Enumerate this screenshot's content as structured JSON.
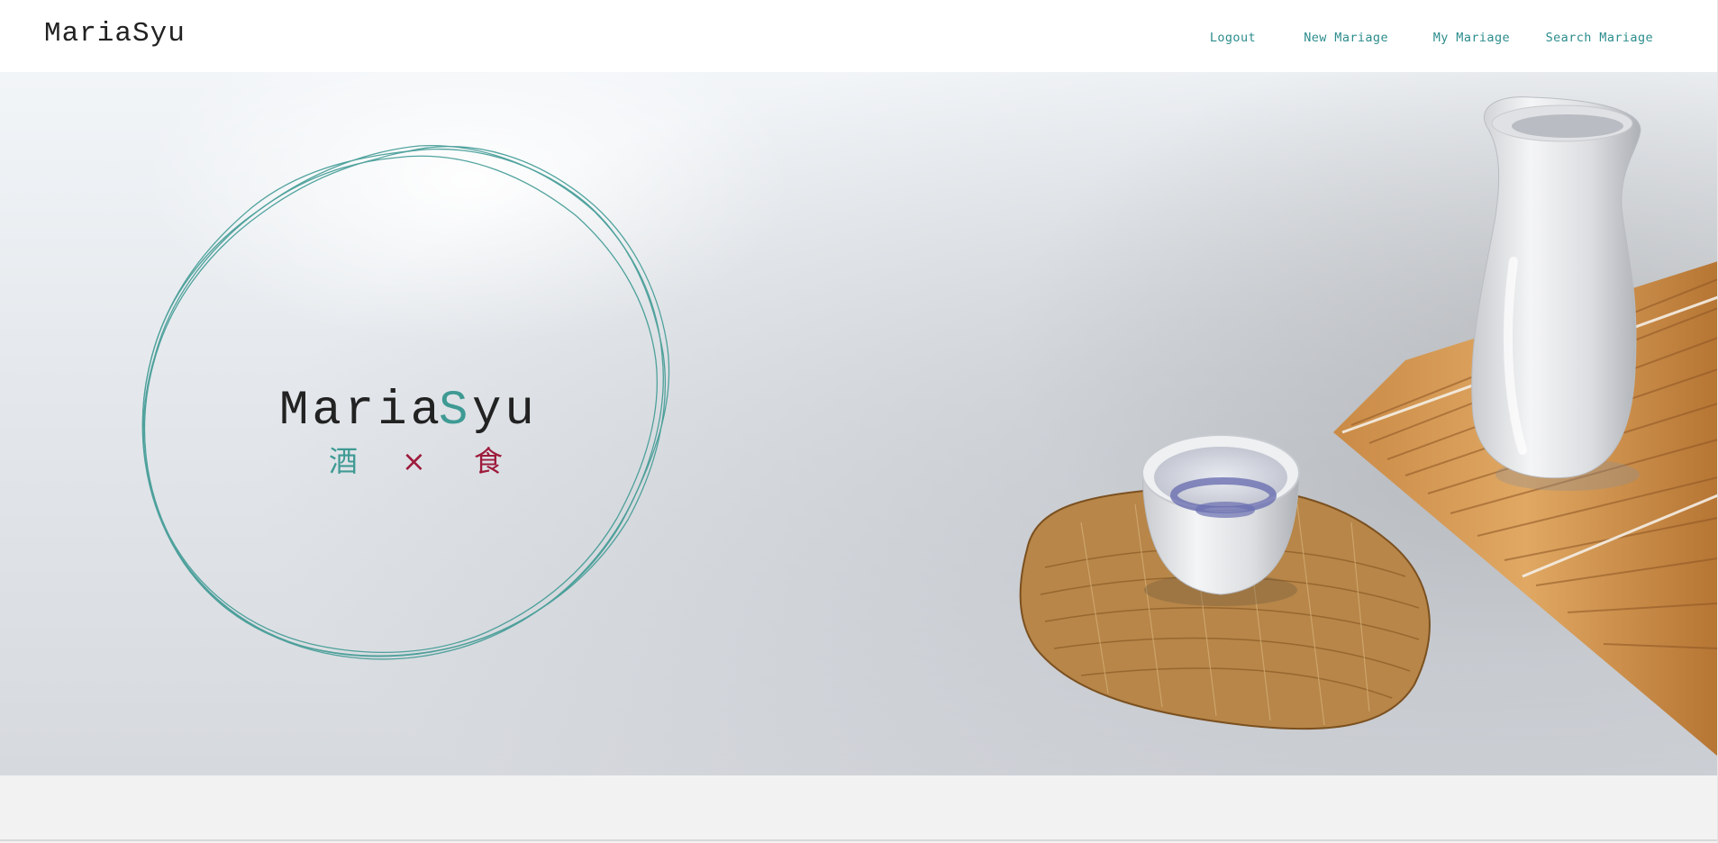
{
  "header": {
    "brand": "MariaSyu",
    "nav": [
      {
        "label": "Logout"
      },
      {
        "label": "New Mariage"
      },
      {
        "label": "My Mariage"
      },
      {
        "label": "Search Mariage"
      }
    ]
  },
  "hero": {
    "logo": {
      "title_part1": "Maria",
      "title_part2": "S",
      "title_part3": "yu",
      "kanji_sake": "酒",
      "kanji_cross": "×",
      "kanji_food": "食"
    }
  },
  "colors": {
    "accent_teal": "#2c8c8c",
    "accent_red": "#9e1b3c",
    "text_dark": "#222222"
  }
}
